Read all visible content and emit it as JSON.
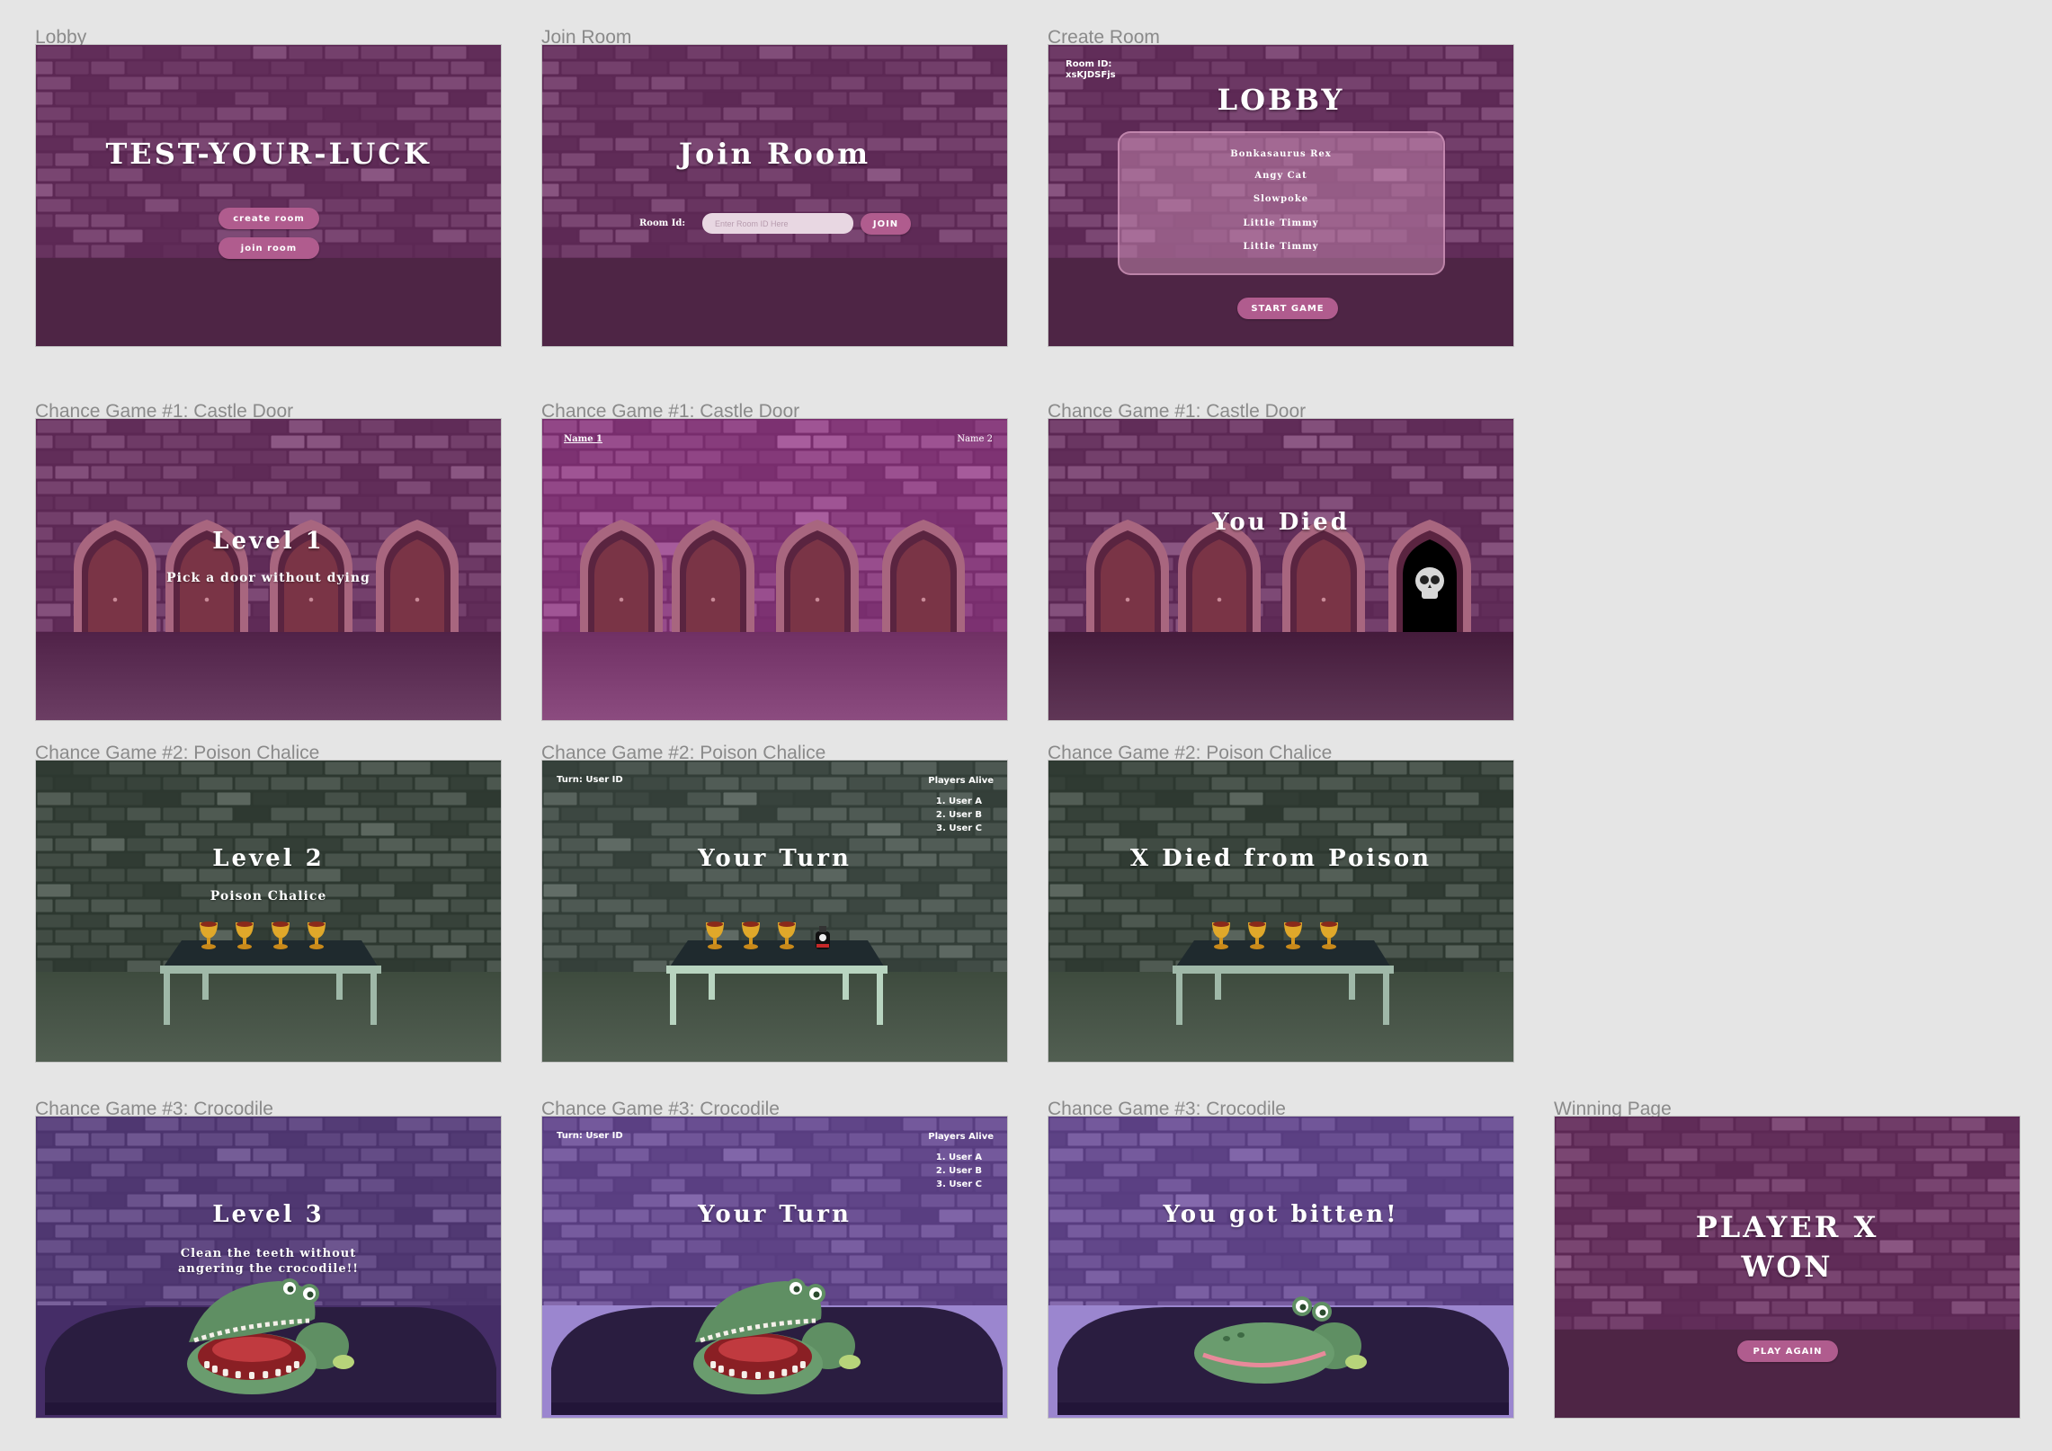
{
  "frames": {
    "lobby": {
      "label": "Lobby",
      "title": "TEST-YOUR-LUCK",
      "create_button": "create room",
      "join_button": "join room"
    },
    "join_room": {
      "label": "Join Room",
      "title": "Join Room",
      "room_id_label": "Room Id:",
      "room_id_placeholder": "Enter Room ID Here",
      "join_button": "JOIN"
    },
    "create_room": {
      "label": "Create Room",
      "room_id_label": "Room ID:",
      "room_id_value": "xsKJDSFjs",
      "title": "LOBBY",
      "players": [
        "Bonkasaurus Rex",
        "Angy Cat",
        "Slowpoke",
        "Little Timmy",
        "Little Timmy"
      ],
      "start_button": "START GAME"
    },
    "castle_1": {
      "label": "Chance Game #1: Castle Door",
      "title": "Level 1",
      "subtitle": "Pick a door without dying"
    },
    "castle_2": {
      "label": "Chance Game #1: Castle Door",
      "name_left": "Name 1",
      "name_right": "Name 2"
    },
    "castle_3": {
      "label": "Chance Game #1: Castle Door",
      "title": "You Died"
    },
    "poison_1": {
      "label": "Chance Game #2: Poison Chalice",
      "title": "Level 2",
      "subtitle": "Poison Chalice"
    },
    "poison_2": {
      "label": "Chance Game #2: Poison Chalice",
      "turn_text": "Turn: User ID",
      "players_title": "Players Alive",
      "players": [
        "1. User A",
        "2. User B",
        "3. User C"
      ],
      "title": "Your Turn"
    },
    "poison_3": {
      "label": "Chance Game #2: Poison Chalice",
      "title": "X Died from Poison"
    },
    "croc_1": {
      "label": "Chance Game #3: Crocodile",
      "title": "Level 3",
      "subtitle_line1": "Clean the teeth without",
      "subtitle_line2": "angering the crocodile!!"
    },
    "croc_2": {
      "label": "Chance Game #3: Crocodile",
      "turn_text": "Turn: User ID",
      "players_title": "Players Alive",
      "players": [
        "1. User A",
        "2. User B",
        "3. User C"
      ],
      "title": "Your Turn"
    },
    "croc_3": {
      "label": "Chance Game #3: Crocodile",
      "title": "You got bitten!"
    },
    "winning": {
      "label": "Winning Page",
      "title_line1": "PLAYER X",
      "title_line2": "WON",
      "play_again_button": "PLAY AGAIN"
    }
  },
  "colors": {
    "canvas": "#e5e5e5",
    "purple_wall": "#6e3a66",
    "purple_floor": "#4e2545",
    "pink_wall": "#8a3f7f",
    "green_wall": "#3f4a42",
    "green_floor": "#4a574a",
    "croc_wall": "#5e4680",
    "croc_floor": "#2a1d40",
    "button": "#b05c8e",
    "crocodile": "#6a9c6e"
  }
}
